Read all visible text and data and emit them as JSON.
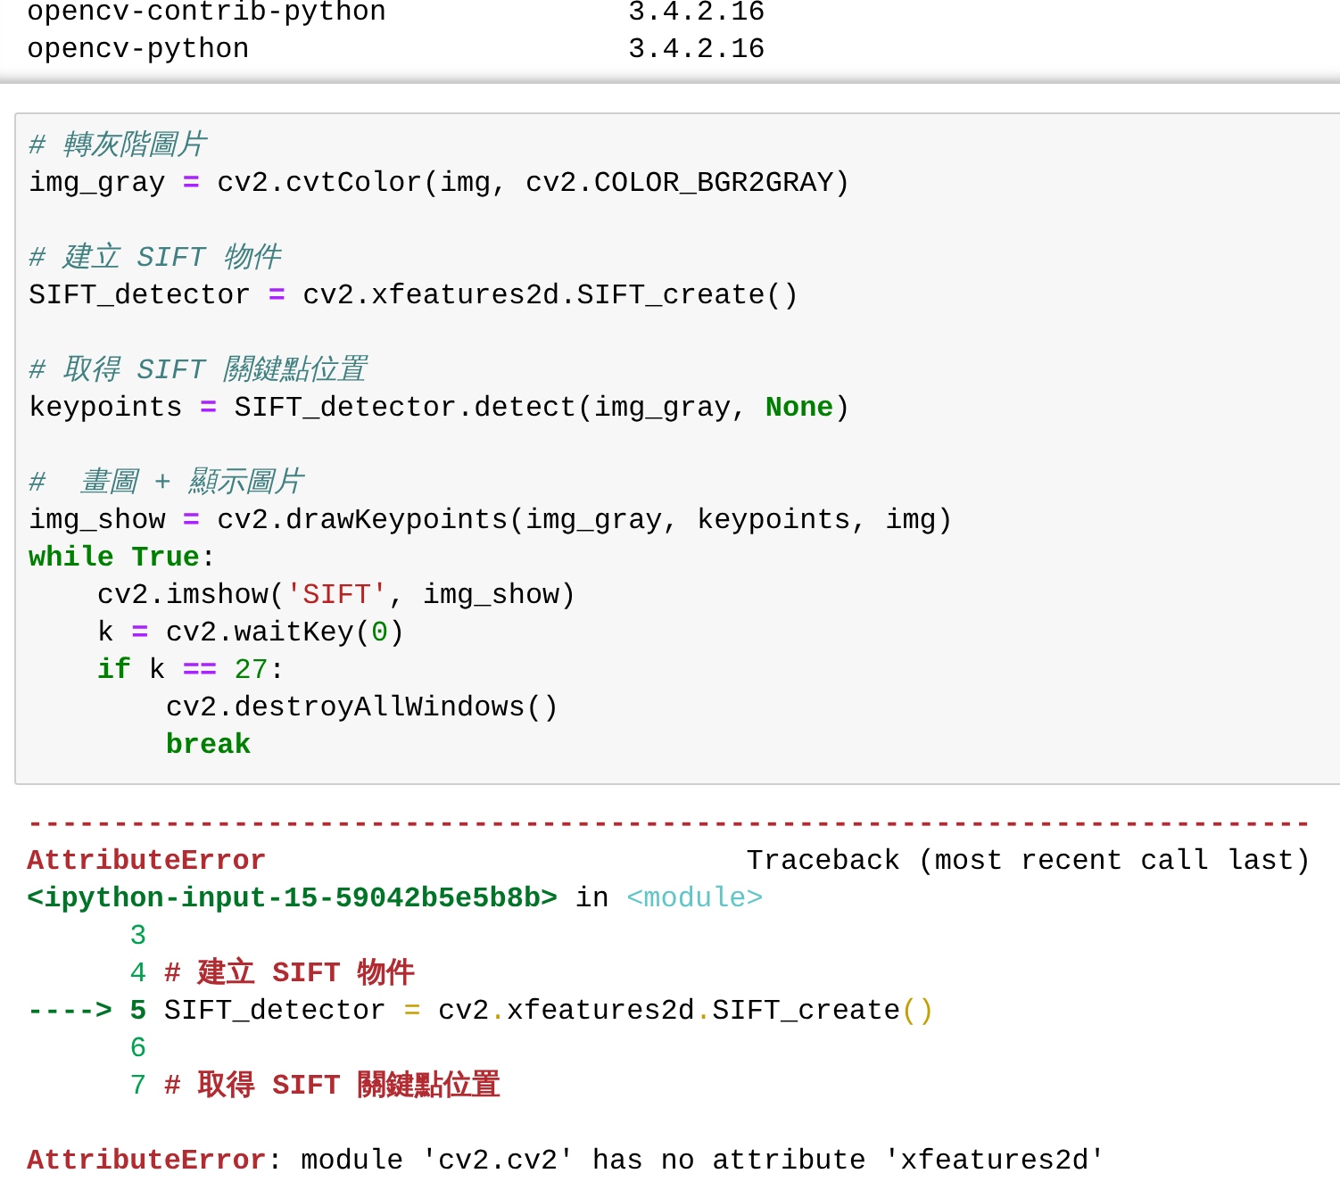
{
  "package_list": [
    {
      "name": "opencv-contrib-python",
      "version": "3.4.2.16"
    },
    {
      "name": "opencv-python",
      "version": "3.4.2.16"
    }
  ],
  "code_cell": {
    "blocks": [
      {
        "lines": [
          [
            {
              "kind": "comment",
              "text": "# 轉灰階圖片"
            }
          ],
          [
            {
              "kind": "name",
              "text": "img_gray "
            },
            {
              "kind": "op",
              "text": "="
            },
            {
              "kind": "name",
              "text": " cv2.cvtColor(img, cv2.COLOR_BGR2GRAY)"
            }
          ]
        ]
      },
      {
        "lines": [
          [
            {
              "kind": "comment",
              "text": "# 建立 SIFT 物件"
            }
          ],
          [
            {
              "kind": "name",
              "text": "SIFT_detector "
            },
            {
              "kind": "op",
              "text": "="
            },
            {
              "kind": "name",
              "text": " cv2.xfeatures2d.SIFT_create()"
            }
          ]
        ]
      },
      {
        "lines": [
          [
            {
              "kind": "comment",
              "text": "# 取得 SIFT 關鍵點位置"
            }
          ],
          [
            {
              "kind": "name",
              "text": "keypoints "
            },
            {
              "kind": "op",
              "text": "="
            },
            {
              "kind": "name",
              "text": " SIFT_detector.detect(img_gray, "
            },
            {
              "kind": "keyword",
              "text": "None"
            },
            {
              "kind": "name",
              "text": ")"
            }
          ]
        ]
      },
      {
        "lines": [
          [
            {
              "kind": "comment",
              "text": "#  畫圖 + 顯示圖片"
            }
          ],
          [
            {
              "kind": "name",
              "text": "img_show "
            },
            {
              "kind": "op",
              "text": "="
            },
            {
              "kind": "name",
              "text": " cv2.drawKeypoints(img_gray, keypoints, img)"
            }
          ],
          [
            {
              "kind": "keyword",
              "text": "while"
            },
            {
              "kind": "keyword",
              "text": " True"
            },
            {
              "kind": "name",
              "text": ":"
            }
          ],
          [
            {
              "kind": "name",
              "text": "    cv2.imshow("
            },
            {
              "kind": "string",
              "text": "'SIFT'"
            },
            {
              "kind": "name",
              "text": ", img_show)"
            }
          ],
          [
            {
              "kind": "name",
              "text": "    k "
            },
            {
              "kind": "op",
              "text": "="
            },
            {
              "kind": "name",
              "text": " cv2.waitKey("
            },
            {
              "kind": "number",
              "text": "0"
            },
            {
              "kind": "name",
              "text": ")"
            }
          ],
          [
            {
              "kind": "keyword",
              "text": "    if"
            },
            {
              "kind": "name",
              "text": " k "
            },
            {
              "kind": "op",
              "text": "=="
            },
            {
              "kind": "number",
              "text": " 27"
            },
            {
              "kind": "name",
              "text": ":"
            }
          ],
          [
            {
              "kind": "name",
              "text": "        cv2.destroyAllWindows()"
            }
          ],
          [
            {
              "kind": "keyword",
              "text": "        break"
            }
          ]
        ]
      }
    ]
  },
  "traceback": {
    "blocks": [
      {
        "lines": [
          [
            {
              "kind": "red_bold",
              "text": "---------------------------------------------------------------------------"
            }
          ],
          [
            {
              "kind": "red_bold",
              "text": "AttributeError"
            },
            {
              "kind": "plain",
              "text": "                            Traceback (most recent call last)"
            }
          ],
          [
            {
              "kind": "green_bold",
              "text": "<ipython-input-15-59042b5e5b8b>"
            },
            {
              "kind": "plain",
              "text": " in "
            },
            {
              "kind": "cyan",
              "text": "<module>"
            }
          ],
          [
            {
              "kind": "green",
              "text": "      3"
            }
          ],
          [
            {
              "kind": "green",
              "text": "      4 "
            },
            {
              "kind": "red_bold",
              "text": "# 建立 SIFT 物件"
            }
          ],
          [
            {
              "kind": "green_bold",
              "text": "----> 5"
            },
            {
              "kind": "plain",
              "text": " SIFT_detector "
            },
            {
              "kind": "yellow",
              "text": "="
            },
            {
              "kind": "plain",
              "text": " cv2"
            },
            {
              "kind": "yellow",
              "text": "."
            },
            {
              "kind": "plain",
              "text": "xfeatures2d"
            },
            {
              "kind": "yellow",
              "text": "."
            },
            {
              "kind": "plain",
              "text": "SIFT_create"
            },
            {
              "kind": "yellow",
              "text": "()"
            }
          ],
          [
            {
              "kind": "green",
              "text": "      6"
            }
          ],
          [
            {
              "kind": "green",
              "text": "      7 "
            },
            {
              "kind": "red_bold",
              "text": "# 取得 SIFT 關鍵點位置"
            }
          ]
        ]
      },
      {
        "lines": [
          [
            {
              "kind": "red_bold",
              "text": "AttributeError"
            },
            {
              "kind": "plain",
              "text": ": module 'cv2.cv2' has no attribute 'xfeatures2d'"
            }
          ]
        ]
      }
    ]
  }
}
